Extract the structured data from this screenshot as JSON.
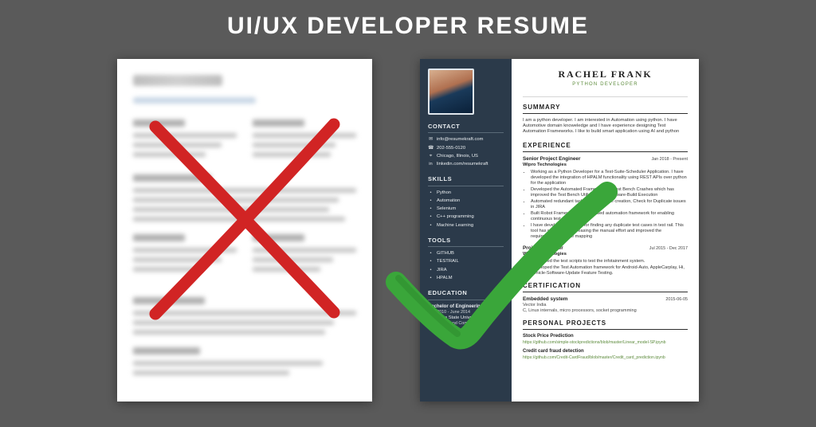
{
  "title": "UI/UX DEVELOPER RESUME",
  "resume": {
    "name": "RACHEL FRANK",
    "role": "PYTHON DEVELOPER",
    "summary": "I am a python developer. I am interested in Automation using python. I have Automotive domain knoweledge and I have experience designing Test Automation Frameworks. I like to build smart application using AI and python",
    "contact": {
      "head": "CONTACT",
      "email": "info@resumekraft.com",
      "phone": "202-555-0120",
      "location": "Chicago, Illinois, US",
      "linkedin": "linkedin.com/resumekraft"
    },
    "skills": {
      "head": "SKILLS",
      "items": [
        "Python",
        "Automation",
        "Selenium",
        "C++ programming",
        "Machine Learning"
      ]
    },
    "tools": {
      "head": "TOOLS",
      "items": [
        "GITHUB",
        "TESTRAIL",
        "JIRA",
        "HPALM"
      ]
    },
    "education": {
      "head": "EDUCATION",
      "degree": "Bachelor of Engineering",
      "date": "Sep 2010 - June 2014",
      "school": "San Jose State University",
      "field": "Electronics and Communication"
    },
    "experience": {
      "head": "EXPERIENCE",
      "jobs": [
        {
          "title": "Senior Project Engineer",
          "company": "Wipro Technologies",
          "date": "Jan 2018 - Present",
          "bullets": [
            "Working as a Python Developer for a Test-Suite-Scheduler Application. I have developed the integration of HPALM functionality using REST APIs over python for the application",
            "Developed the Automated Framework for Test Bench Crashes which has improved the Test Bench Utilization for Software-Build Execution",
            "Automated redundant tasks such as issue creation, Check for Duplicate issues in JIRA",
            "Built Robot Framework-python based automation framework for enabling continuous test execution",
            "I have developed the tools for finding any duplicate test cases in test rail. This tool has resulted in decreasing the manual effort and improved the requirement-test case mapping"
          ]
        },
        {
          "title": "Project Engineer",
          "company": "Wipro Technologies",
          "date": "Jul 2015 - Dec 2017",
          "bullets": [
            "Developed the test scripts to test the infotainment system.",
            "Developed the Test Automation framework for Android-Auto, AppleCarplay, Hi, Vehicle-Software-Update Feature Testing."
          ]
        }
      ]
    },
    "certification": {
      "head": "CERTIFICATION",
      "title": "Embedded system",
      "org": "Vector India",
      "date": "2015-06-05",
      "desc": "C, Linux internals, micro processors, socket programming"
    },
    "projects": {
      "head": "PERSONAL PROJECTS",
      "items": [
        {
          "title": "Stock Price Prediction",
          "link": "https://github.com/simple-stockpredictions/blob/master/Linear_model-SP.ipynb"
        },
        {
          "title": "Credit card fraud detection",
          "link": "https://github.com/Credit-CardFraud/blob/master/Credit_card_prediction.ipynb"
        }
      ]
    }
  }
}
